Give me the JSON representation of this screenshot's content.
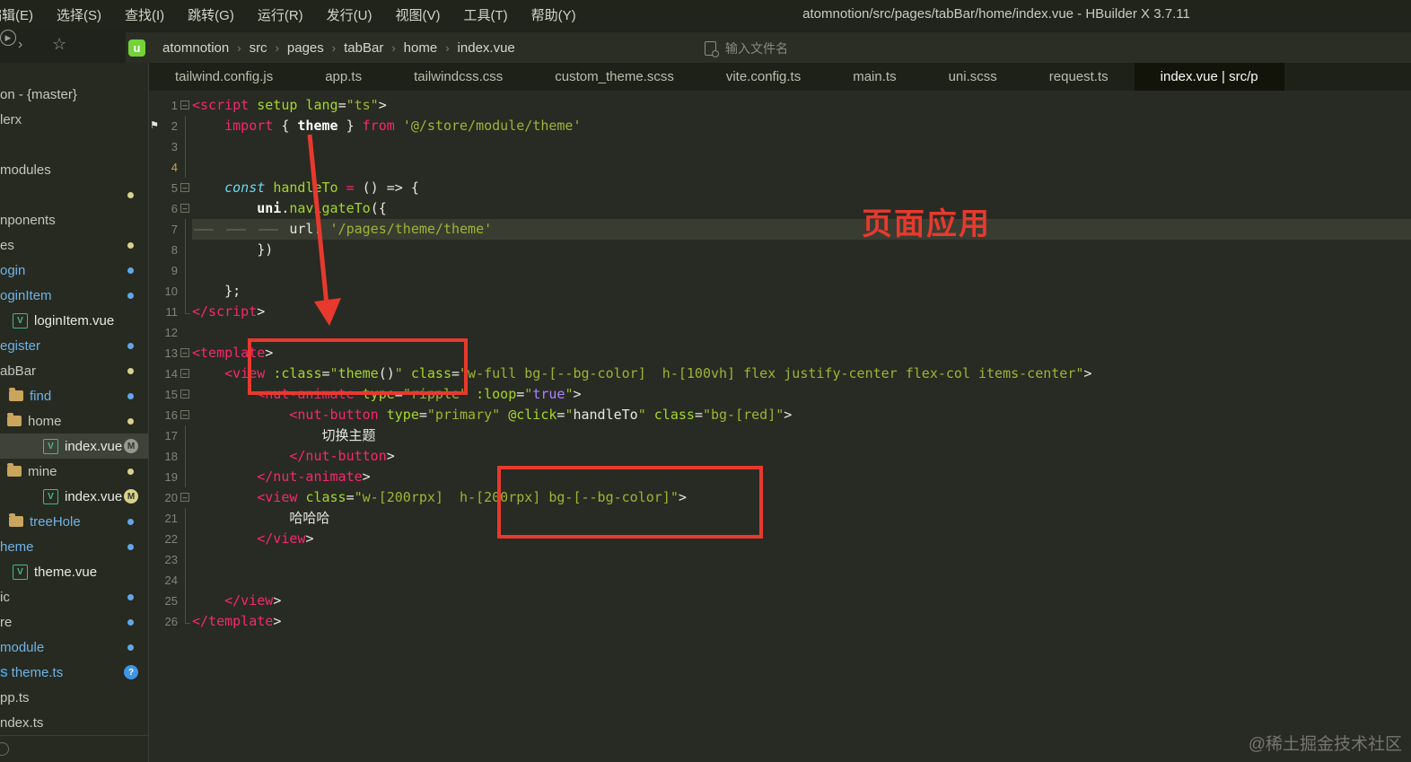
{
  "window": {
    "title": "atomnotion/src/pages/tabBar/home/index.vue - HBuilder X 3.7.11",
    "menus": [
      "编辑(E)",
      "选择(S)",
      "查找(I)",
      "跳转(G)",
      "运行(R)",
      "发行(U)",
      "视图(V)",
      "工具(T)",
      "帮助(Y)"
    ]
  },
  "toolbar": {
    "logo_letter": "u",
    "breadcrumb": [
      "atomnotion",
      "src",
      "pages",
      "tabBar",
      "home",
      "index.vue"
    ],
    "search_placeholder": "输入文件名",
    "icons": [
      "chevron-right-icon",
      "star-icon",
      "run-icon",
      "uniapp-logo-icon",
      "file-search-icon"
    ]
  },
  "tabs": [
    {
      "label": "tailwind.config.js",
      "active": false
    },
    {
      "label": "app.ts",
      "active": false
    },
    {
      "label": "tailwindcss.css",
      "active": false
    },
    {
      "label": "custom_theme.scss",
      "active": false
    },
    {
      "label": "vite.config.ts",
      "active": false
    },
    {
      "label": "main.ts",
      "active": false
    },
    {
      "label": "uni.scss",
      "active": false
    },
    {
      "label": "request.ts",
      "active": false
    },
    {
      "label": "index.vue | src/p",
      "active": true
    }
  ],
  "sidebar": {
    "items": [
      {
        "label": "on - {master}",
        "color": "gray",
        "icon": "",
        "indent": 0,
        "badge": "",
        "selected": false
      },
      {
        "label": "lerx",
        "color": "gray",
        "icon": "",
        "indent": 0,
        "badge": "",
        "selected": false
      },
      {
        "label": "",
        "color": "gray",
        "icon": "",
        "indent": 0,
        "badge": "",
        "selected": false
      },
      {
        "label": "modules",
        "color": "gray",
        "icon": "",
        "indent": 0,
        "badge": "",
        "selected": false
      },
      {
        "label": "",
        "color": "gray",
        "icon": "",
        "indent": 0,
        "badge": "ydot",
        "selected": false
      },
      {
        "label": "nponents",
        "color": "gray",
        "icon": "",
        "indent": 0,
        "badge": "",
        "selected": false
      },
      {
        "label": "es",
        "color": "gray",
        "icon": "",
        "indent": 0,
        "badge": "ydot",
        "selected": false
      },
      {
        "label": "ogin",
        "color": "blue",
        "icon": "",
        "indent": 0,
        "badge": "bdot",
        "selected": false
      },
      {
        "label": "oginItem",
        "color": "blue",
        "icon": "",
        "indent": 0,
        "badge": "bdot",
        "selected": false
      },
      {
        "label": "loginItem.vue",
        "color": "white",
        "icon": "vue",
        "indent": 14,
        "badge": "",
        "selected": false
      },
      {
        "label": "egister",
        "color": "blue",
        "icon": "",
        "indent": 0,
        "badge": "bdot",
        "selected": false
      },
      {
        "label": "abBar",
        "color": "gray",
        "icon": "",
        "indent": 0,
        "badge": "ydot",
        "selected": false
      },
      {
        "label": "find",
        "color": "blue",
        "icon": "folder",
        "indent": 10,
        "badge": "bdot",
        "selected": false
      },
      {
        "label": "home",
        "color": "gray",
        "icon": "folder",
        "indent": 8,
        "badge": "ydot",
        "selected": false
      },
      {
        "label": "index.vue",
        "color": "white",
        "icon": "vue",
        "indent": 48,
        "badge": "mg",
        "selected": true
      },
      {
        "label": "mine",
        "color": "gray",
        "icon": "folder",
        "indent": 8,
        "badge": "ydot",
        "selected": false
      },
      {
        "label": "index.vue",
        "color": "white",
        "icon": "vue",
        "indent": 48,
        "badge": "my",
        "selected": false
      },
      {
        "label": "treeHole",
        "color": "blue",
        "icon": "folder",
        "indent": 10,
        "badge": "bdot",
        "selected": false
      },
      {
        "label": "heme",
        "color": "blue",
        "icon": "",
        "indent": 0,
        "badge": "bdot",
        "selected": false
      },
      {
        "label": "theme.vue",
        "color": "white",
        "icon": "vue",
        "indent": 14,
        "badge": "",
        "selected": false
      },
      {
        "label": "ic",
        "color": "gray",
        "icon": "",
        "indent": 0,
        "badge": "bdot",
        "selected": false
      },
      {
        "label": "re",
        "color": "gray",
        "icon": "",
        "indent": 0,
        "badge": "bdot",
        "selected": false
      },
      {
        "label": "module",
        "color": "blue",
        "icon": "",
        "indent": 0,
        "badge": "bdot",
        "selected": false
      },
      {
        "label": "theme.ts",
        "color": "blue",
        "icon": "ts",
        "indent": 0,
        "badge": "qb",
        "selected": false
      },
      {
        "label": "pp.ts",
        "color": "gray",
        "icon": "",
        "indent": 0,
        "badge": "",
        "selected": false
      },
      {
        "label": "ndex.ts",
        "color": "gray",
        "icon": "",
        "indent": 0,
        "badge": "",
        "selected": false
      }
    ]
  },
  "editor": {
    "lines": [
      {
        "n": 1,
        "f": true,
        "t": [
          [
            "<script",
            "tag"
          ],
          [
            " ",
            "pl"
          ],
          [
            "setup",
            "attr"
          ],
          [
            " ",
            "pl"
          ],
          [
            "lang",
            "attr"
          ],
          [
            "=",
            "pl"
          ],
          [
            "\"ts\"",
            "str"
          ],
          [
            ">",
            "pl"
          ]
        ]
      },
      {
        "n": 2,
        "b": true,
        "g": "v",
        "t": [
          [
            "    ",
            "pl"
          ],
          [
            "import",
            "kw"
          ],
          [
            " { ",
            "pl"
          ],
          [
            "theme",
            "bold"
          ],
          [
            " } ",
            "pl"
          ],
          [
            "from",
            "kw"
          ],
          [
            " ",
            "pl"
          ],
          [
            "'@/store/module/theme'",
            "str"
          ]
        ]
      },
      {
        "n": 3,
        "g": "v",
        "t": []
      },
      {
        "n": 4,
        "g": "v",
        "y": true,
        "t": []
      },
      {
        "n": 5,
        "f": true,
        "t": [
          [
            "    ",
            "pl"
          ],
          [
            "const",
            "kw2"
          ],
          [
            " ",
            "pl"
          ],
          [
            "handleTo",
            "attr"
          ],
          [
            " ",
            "pl"
          ],
          [
            "=",
            "kw"
          ],
          [
            " () => {",
            "pl"
          ]
        ]
      },
      {
        "n": 6,
        "f": true,
        "t": [
          [
            "        ",
            "pl"
          ],
          [
            "uni",
            "bold"
          ],
          [
            ".",
            "pl"
          ],
          [
            "navigateTo",
            "attr"
          ],
          [
            "({",
            "pl"
          ]
        ]
      },
      {
        "n": 7,
        "h": true,
        "g": "v",
        "t": [
          [
            "            ",
            "pl"
          ],
          [
            "url",
            "pl"
          ],
          [
            ": ",
            "pl"
          ],
          [
            "'/pages/theme/theme'",
            "str"
          ]
        ]
      },
      {
        "n": 8,
        "g": "v",
        "t": [
          [
            "        ",
            "pl"
          ],
          [
            "})",
            "pl"
          ]
        ]
      },
      {
        "n": 9,
        "g": "v",
        "t": []
      },
      {
        "n": 10,
        "g": "v",
        "t": [
          [
            "    ",
            "pl"
          ],
          [
            "};",
            "pl"
          ]
        ]
      },
      {
        "n": 11,
        "g": "c",
        "t": [
          [
            "</script",
            "tag"
          ],
          [
            ">",
            "pl"
          ]
        ]
      },
      {
        "n": 12,
        "t": []
      },
      {
        "n": 13,
        "f": true,
        "t": [
          [
            "<template",
            "tag"
          ],
          [
            ">",
            "pl"
          ]
        ]
      },
      {
        "n": 14,
        "f": true,
        "t": [
          [
            "    ",
            "pl"
          ],
          [
            "<view",
            "tag"
          ],
          [
            " ",
            "pl"
          ],
          [
            ":class",
            "attr"
          ],
          [
            "=",
            "pl"
          ],
          [
            "\"",
            "str"
          ],
          [
            "theme",
            "attr"
          ],
          [
            "()",
            "pl"
          ],
          [
            "\"",
            "str"
          ],
          [
            " ",
            "pl"
          ],
          [
            "class",
            "attr"
          ],
          [
            "=",
            "pl"
          ],
          [
            "\"w-full bg-[--bg-color]  h-[100vh] flex justify-center flex-col items-center\"",
            "str"
          ],
          [
            ">",
            "pl"
          ]
        ]
      },
      {
        "n": 15,
        "f": true,
        "t": [
          [
            "        ",
            "pl"
          ],
          [
            "<nut-animate",
            "tag"
          ],
          [
            " ",
            "pl"
          ],
          [
            "type",
            "attr"
          ],
          [
            "=",
            "pl"
          ],
          [
            "\"ripple\"",
            "str"
          ],
          [
            " ",
            "pl"
          ],
          [
            ":loop",
            "attr"
          ],
          [
            "=",
            "pl"
          ],
          [
            "\"",
            "str"
          ],
          [
            "true",
            "lit"
          ],
          [
            "\"",
            "str"
          ],
          [
            ">",
            "pl"
          ]
        ]
      },
      {
        "n": 16,
        "f": true,
        "t": [
          [
            "            ",
            "pl"
          ],
          [
            "<nut-button",
            "tag"
          ],
          [
            " ",
            "pl"
          ],
          [
            "type",
            "attr"
          ],
          [
            "=",
            "pl"
          ],
          [
            "\"primary\"",
            "str"
          ],
          [
            " ",
            "pl"
          ],
          [
            "@click",
            "attr"
          ],
          [
            "=",
            "pl"
          ],
          [
            "\"",
            "str"
          ],
          [
            "handleTo",
            "pl"
          ],
          [
            "\"",
            "str"
          ],
          [
            " ",
            "pl"
          ],
          [
            "class",
            "attr"
          ],
          [
            "=",
            "pl"
          ],
          [
            "\"bg-[red]\"",
            "str"
          ],
          [
            ">",
            "pl"
          ]
        ]
      },
      {
        "n": 17,
        "g": "v",
        "t": [
          [
            "                ",
            "pl"
          ],
          [
            "切换主题",
            "pl"
          ]
        ]
      },
      {
        "n": 18,
        "g": "v",
        "t": [
          [
            "            ",
            "pl"
          ],
          [
            "</nut-button",
            "tag"
          ],
          [
            ">",
            "pl"
          ]
        ]
      },
      {
        "n": 19,
        "g": "v",
        "t": [
          [
            "        ",
            "pl"
          ],
          [
            "</nut-animate",
            "tag"
          ],
          [
            ">",
            "pl"
          ]
        ]
      },
      {
        "n": 20,
        "f": true,
        "t": [
          [
            "        ",
            "pl"
          ],
          [
            "<view",
            "tag"
          ],
          [
            " ",
            "pl"
          ],
          [
            "class",
            "attr"
          ],
          [
            "=",
            "pl"
          ],
          [
            "\"w-[200rpx]  h-[200rpx] bg-[--bg-color]\"",
            "str"
          ],
          [
            ">",
            "pl"
          ]
        ]
      },
      {
        "n": 21,
        "g": "v",
        "t": [
          [
            "            ",
            "pl"
          ],
          [
            "哈哈哈",
            "pl"
          ]
        ]
      },
      {
        "n": 22,
        "g": "v",
        "t": [
          [
            "        ",
            "pl"
          ],
          [
            "</view",
            "tag"
          ],
          [
            ">",
            "pl"
          ]
        ]
      },
      {
        "n": 23,
        "g": "v",
        "t": []
      },
      {
        "n": 24,
        "g": "v",
        "t": []
      },
      {
        "n": 25,
        "g": "v",
        "t": [
          [
            "    ",
            "pl"
          ],
          [
            "</view",
            "tag"
          ],
          [
            ">",
            "pl"
          ]
        ]
      },
      {
        "n": 26,
        "g": "c",
        "t": [
          [
            "</template",
            "tag"
          ],
          [
            ">",
            "pl"
          ]
        ]
      }
    ]
  },
  "annotations": {
    "label": "页面应用"
  },
  "watermark": "@稀土掘金技术社区",
  "colors": {
    "annotation_red": "#e8392e",
    "editor_bg": "#282b23",
    "tag_pink": "#f92672",
    "attr_green": "#a6d629",
    "string_olive": "#9fb334",
    "keyword_cyan": "#66d9ef",
    "literal_purple": "#ae81ff",
    "dot_yellow": "#d8d28c",
    "dot_blue": "#62a6ea",
    "uniapp_green": "#74d337"
  }
}
